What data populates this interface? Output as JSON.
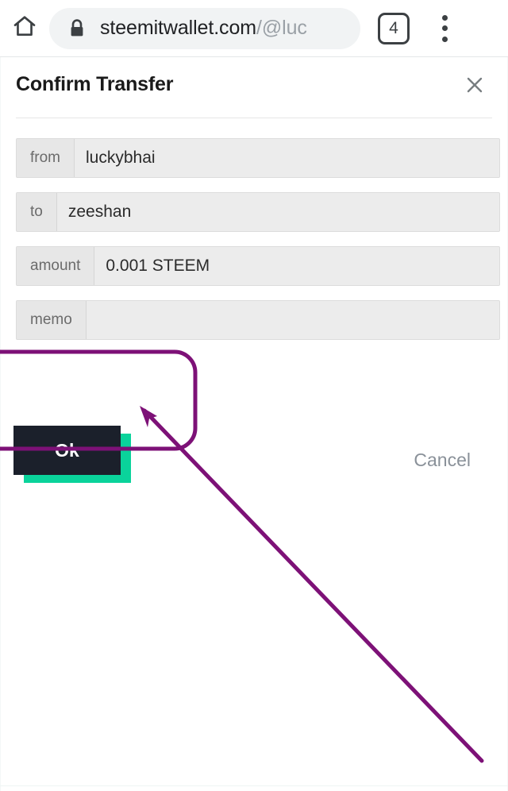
{
  "browser": {
    "home_icon": "home-icon",
    "lock_icon": "lock-icon",
    "url_domain": "steemitwallet.com",
    "url_path": "/@luc",
    "tab_count": "4",
    "overflow_icon": "three-dot-menu-icon"
  },
  "dialog": {
    "title": "Confirm Transfer",
    "close_icon": "close-icon",
    "rows": [
      {
        "label": "from",
        "value": "luckybhai"
      },
      {
        "label": "to",
        "value": "zeeshan"
      },
      {
        "label": "amount",
        "value": "0.001 STEEM"
      },
      {
        "label": "memo",
        "value": ""
      }
    ],
    "ok_label": "Ok",
    "cancel_label": "Cancel"
  },
  "annotation": {
    "highlight_shape": "rounded-rectangle",
    "arrow_shape": "arrow-pointing-up-left",
    "color": "#7d1177"
  },
  "colors": {
    "accent_teal": "#0ad39b",
    "button_dark": "#1b202b",
    "annotation_purple": "#7d1177",
    "field_bg": "#ececec",
    "label_bg": "#e7e7e7",
    "cancel_gray": "#8a9199"
  }
}
